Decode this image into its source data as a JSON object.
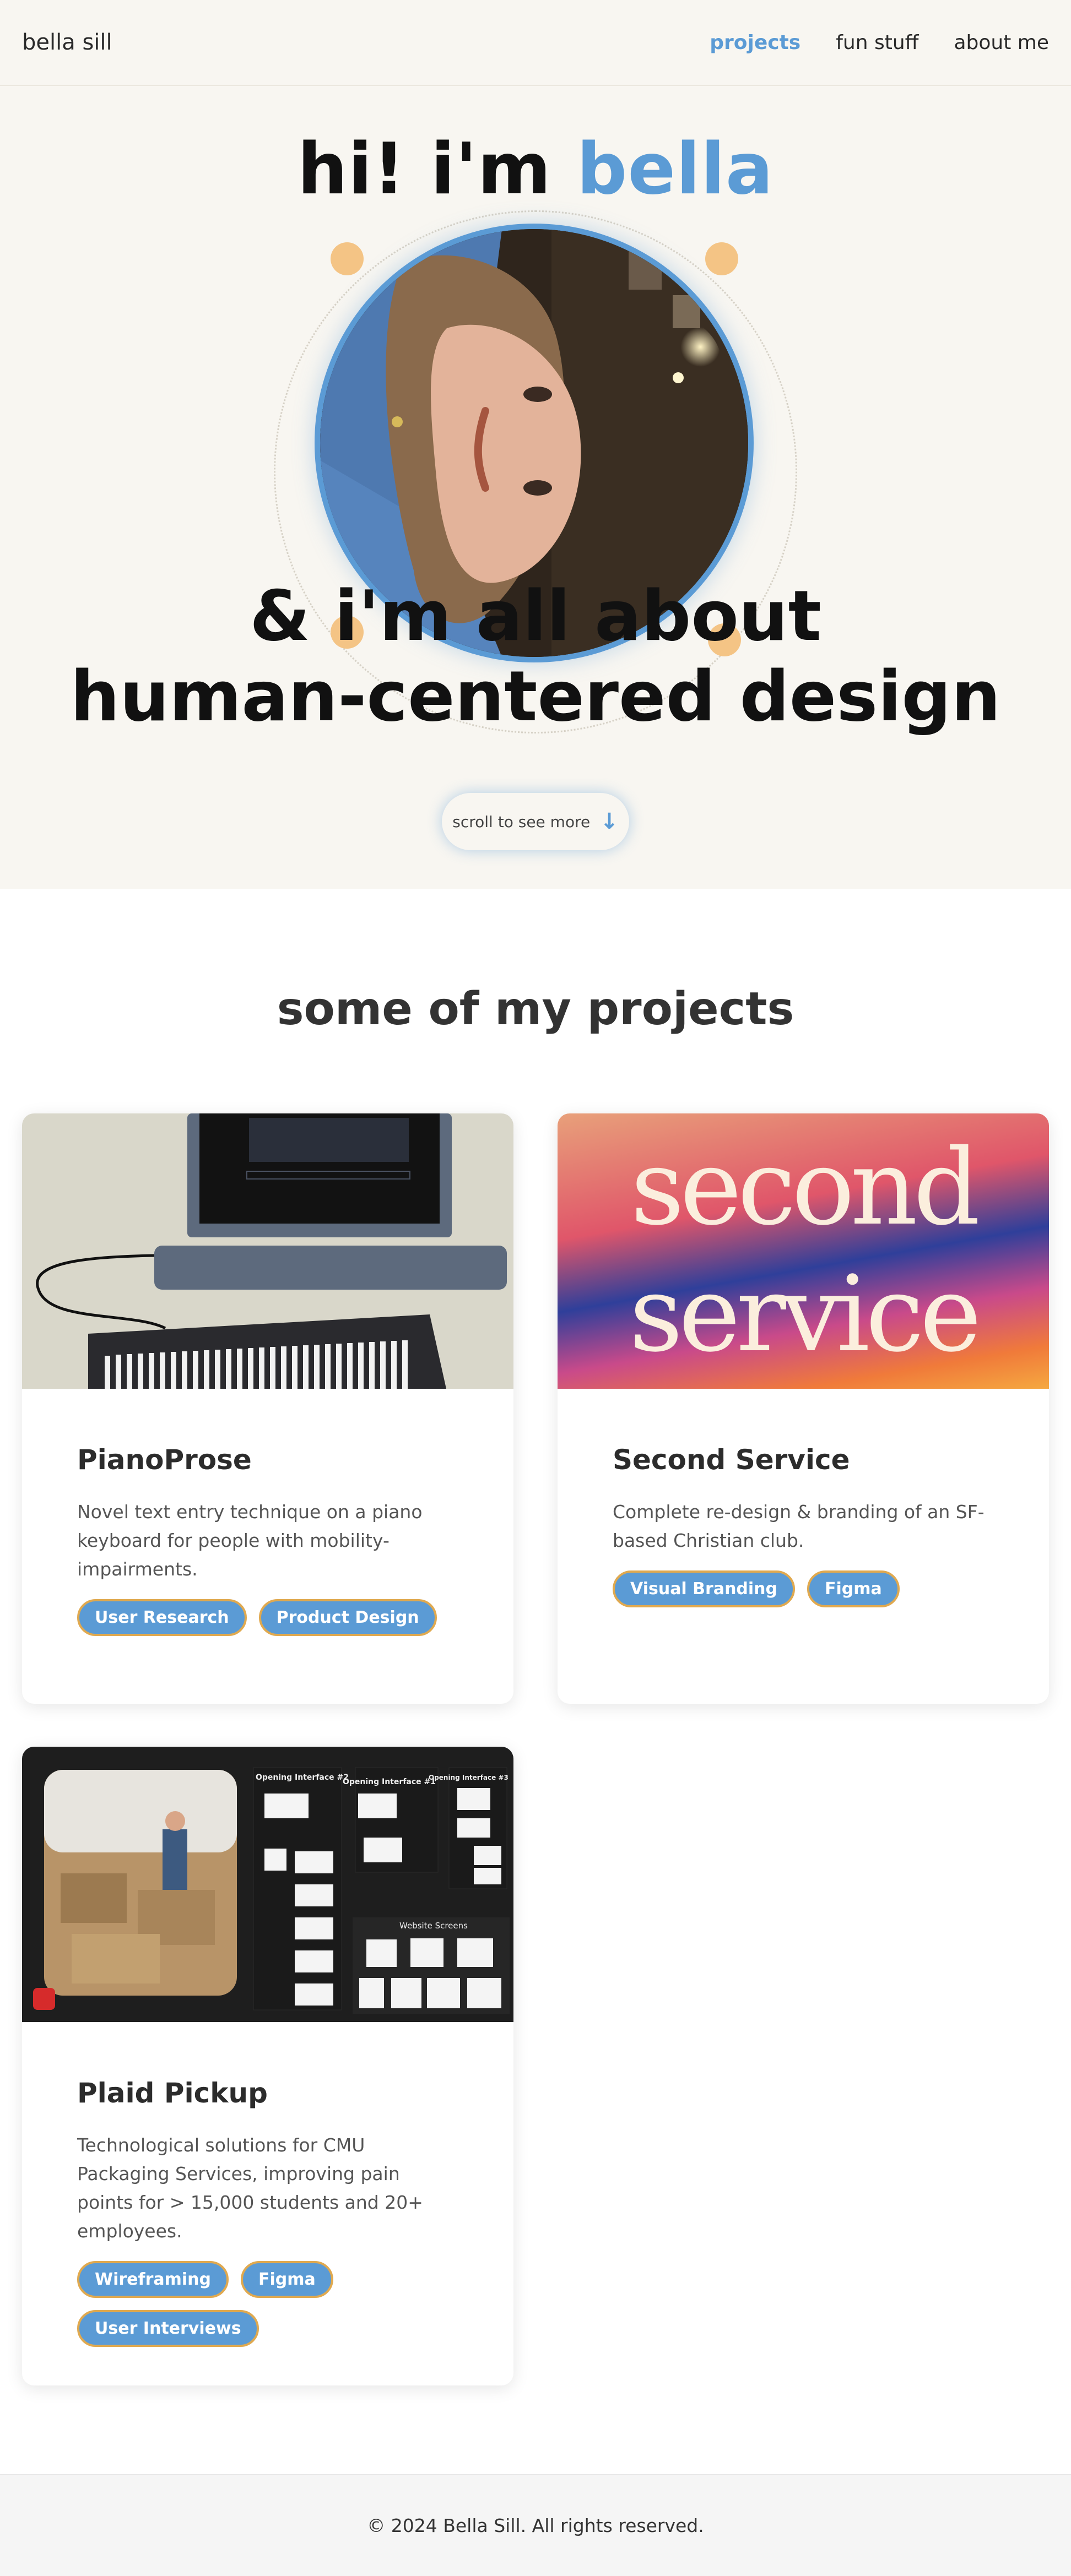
{
  "nav": {
    "brand": "bella sill",
    "links": [
      {
        "label": "projects",
        "active": true
      },
      {
        "label": "fun stuff",
        "active": false
      },
      {
        "label": "about me",
        "active": false
      }
    ]
  },
  "hero": {
    "greeting": "hi! i'm ",
    "name": "bella",
    "tagline_line1": "& i'm all about",
    "tagline_line2": "human-centered design",
    "scroll_label": "scroll to see more",
    "scroll_icon": "arrow-down-icon"
  },
  "projects": {
    "heading": "some of my projects",
    "cards": [
      {
        "title": "PianoProse",
        "description": "Novel text entry technique on a piano keyboard for people with mobility-impairments.",
        "tags": [
          "User Research",
          "Product Design"
        ]
      },
      {
        "title": "Second Service",
        "description": "Complete re-design & branding of an SF-based Christian club.",
        "tags": [
          "Visual Branding",
          "Figma"
        ],
        "image_text_line1": "second",
        "image_text_line2": "service"
      },
      {
        "title": "Plaid Pickup",
        "description": "Technological solutions for CMU Packaging Services, improving pain points for > 15,000 students and 20+ employees.",
        "tags": [
          "Wireframing",
          "Figma",
          "User Interviews"
        ],
        "image_labels": [
          "Opening Interface #2",
          "Opening Interface #1",
          "Opening Interface #3",
          "Website Screens"
        ]
      }
    ]
  },
  "footer": {
    "text": "© 2024 Bella Sill. All rights reserved."
  },
  "colors": {
    "accent": "#5b9bd5",
    "tag_border": "#e0a94f",
    "hero_bg": "#f8f6f1",
    "dot": "#f4c485"
  }
}
